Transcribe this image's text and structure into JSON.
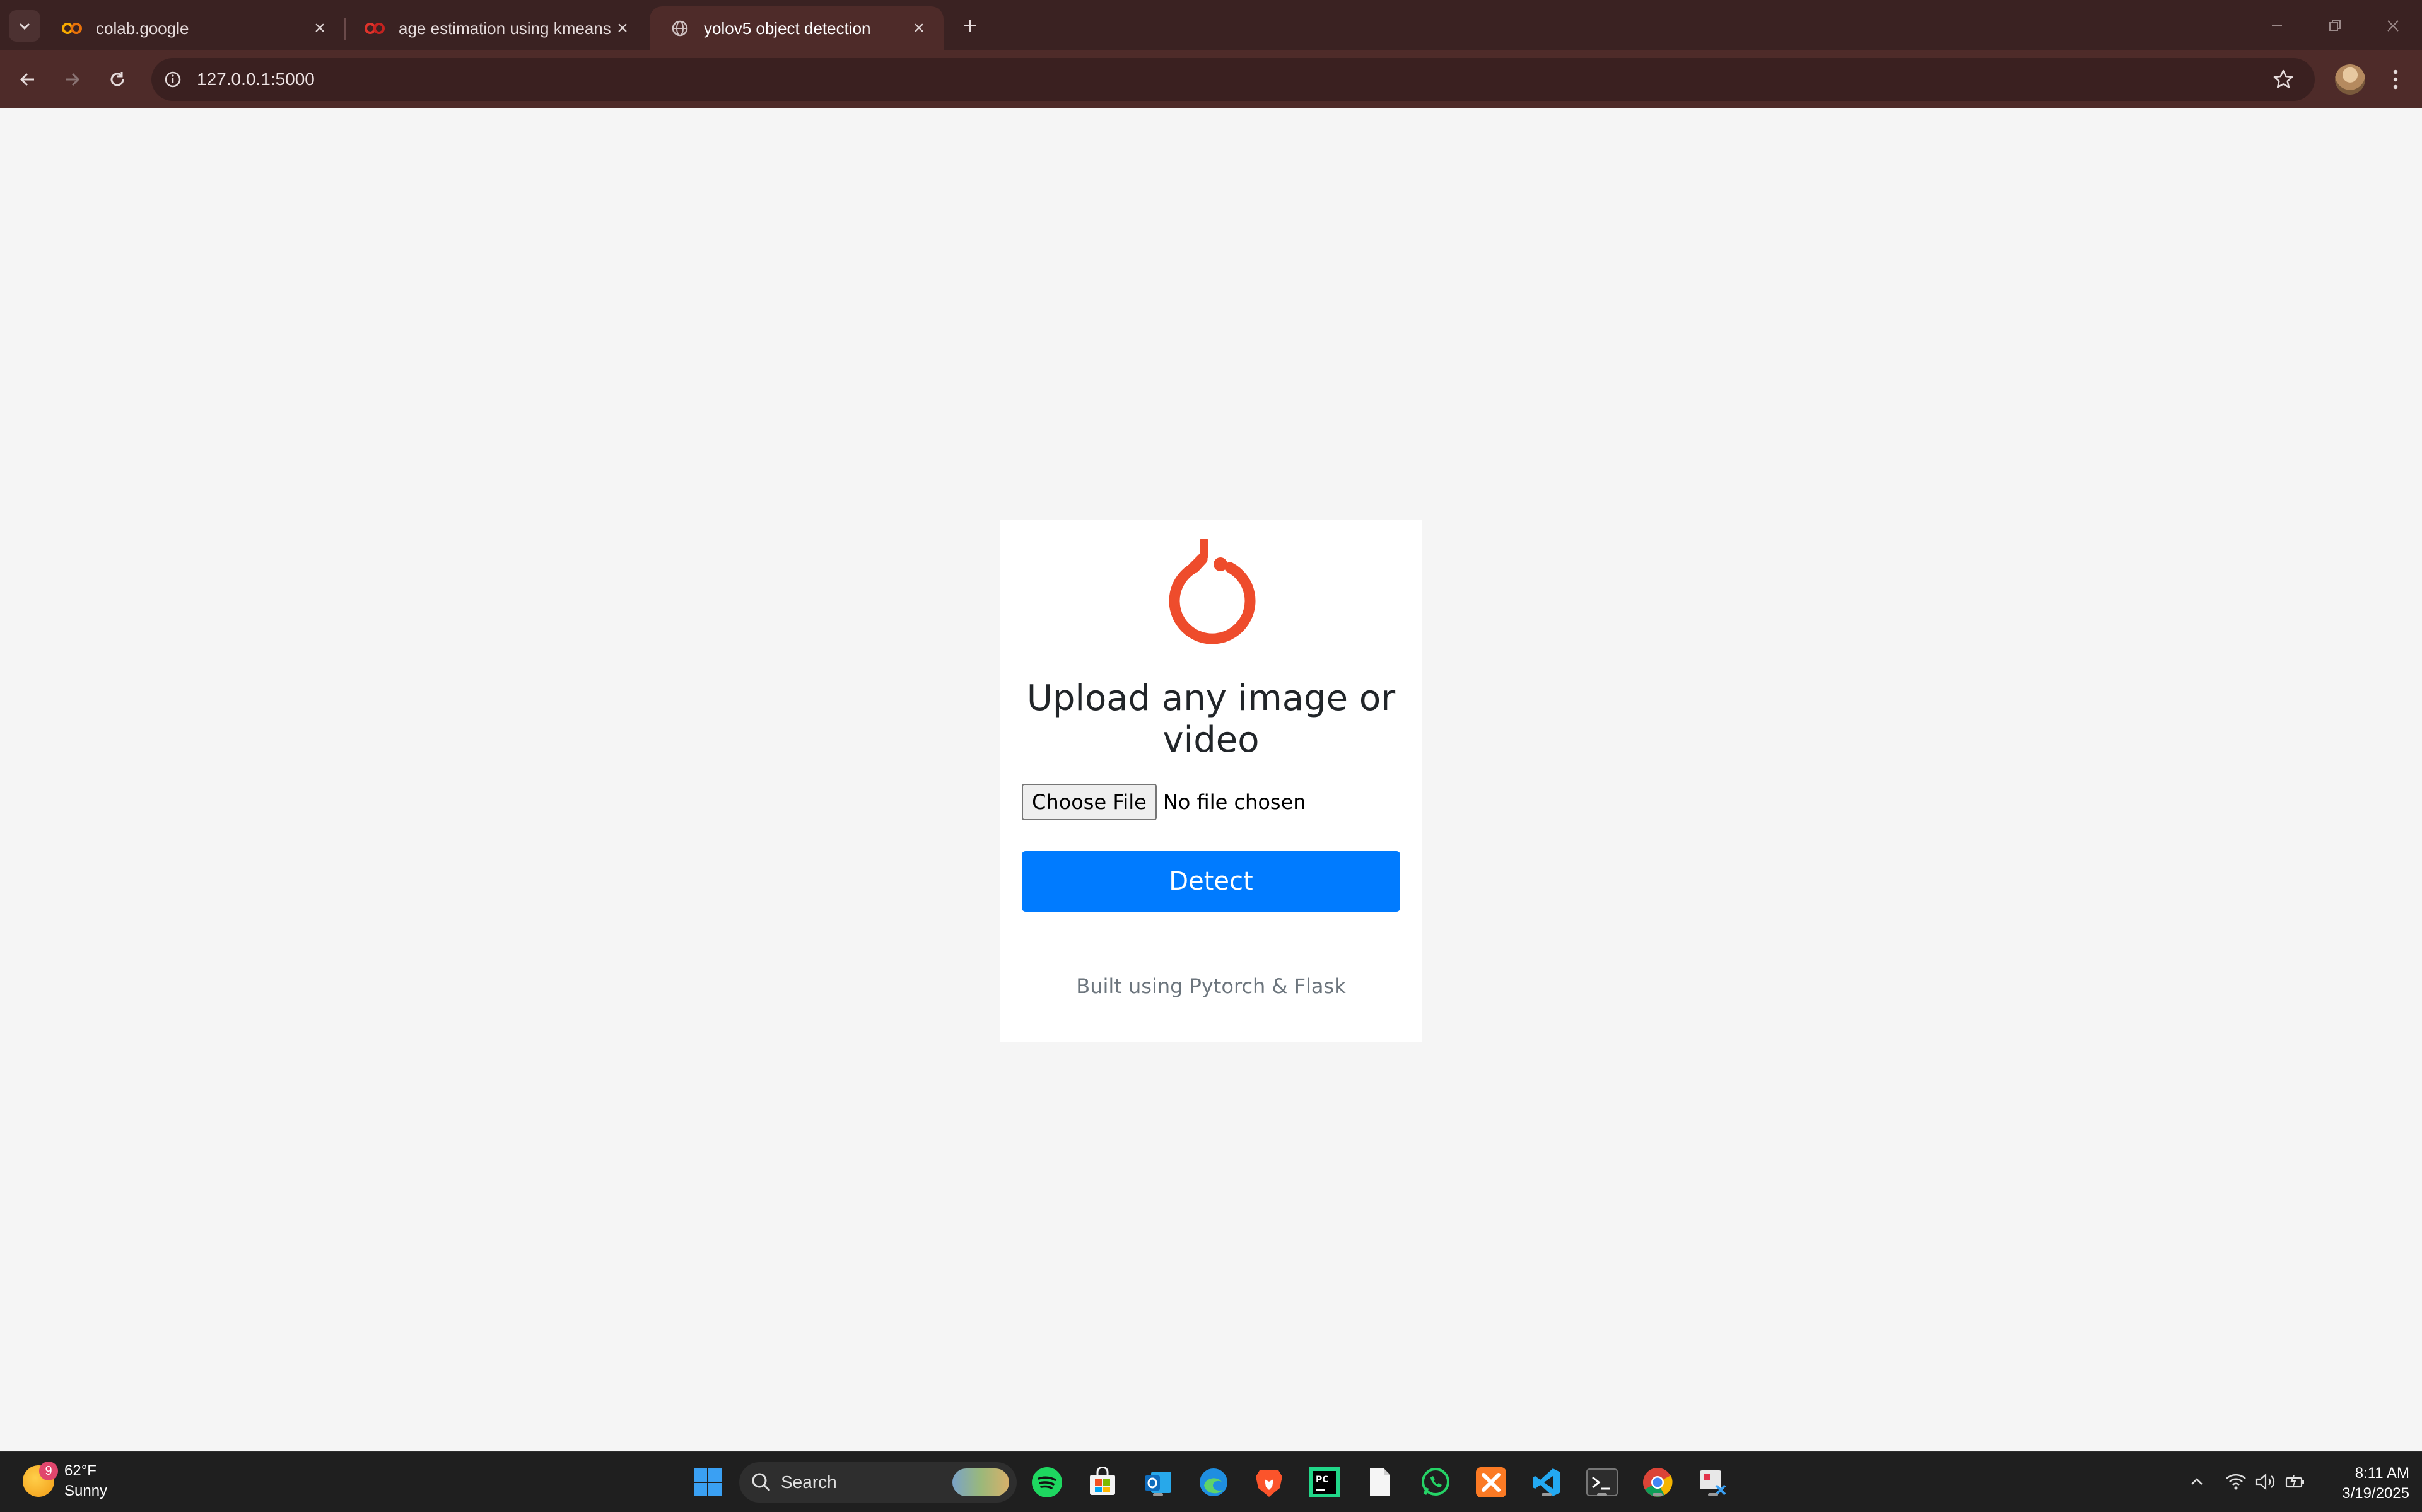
{
  "browser": {
    "tabs": [
      {
        "title": "colab.google",
        "icon": "colab-icon",
        "active": false
      },
      {
        "title": "age estimation using kmeans.ipynb",
        "icon": "colab-icon",
        "active": false
      },
      {
        "title": "yolov5 object detection",
        "icon": "globe-icon",
        "active": true
      }
    ],
    "url": "127.0.0.1:5000",
    "colors": {
      "frame": "#3a2222",
      "toolbar": "#4e2b29"
    }
  },
  "page": {
    "heading": "Upload any image or video",
    "choose_file_label": "Choose File",
    "file_status": "No file chosen",
    "detect_label": "Detect",
    "footer": "Built using Pytorch & Flask",
    "colors": {
      "logo": "#ee4c2c",
      "button": "#007bff",
      "background": "#f5f5f5"
    }
  },
  "taskbar": {
    "weather": {
      "temp": "62°F",
      "condition": "Sunny",
      "badge": "9"
    },
    "search_label": "Search",
    "apps": [
      "windows-start-icon",
      "spotify-icon",
      "microsoft-store-icon",
      "outlook-icon",
      "edge-icon",
      "brave-icon",
      "pycharm-icon",
      "notepad-icon",
      "whatsapp-icon",
      "xampp-icon",
      "vscode-icon",
      "terminal-icon",
      "chrome-icon",
      "snipping-tool-icon"
    ],
    "time": "8:11 AM",
    "date": "3/19/2025"
  }
}
